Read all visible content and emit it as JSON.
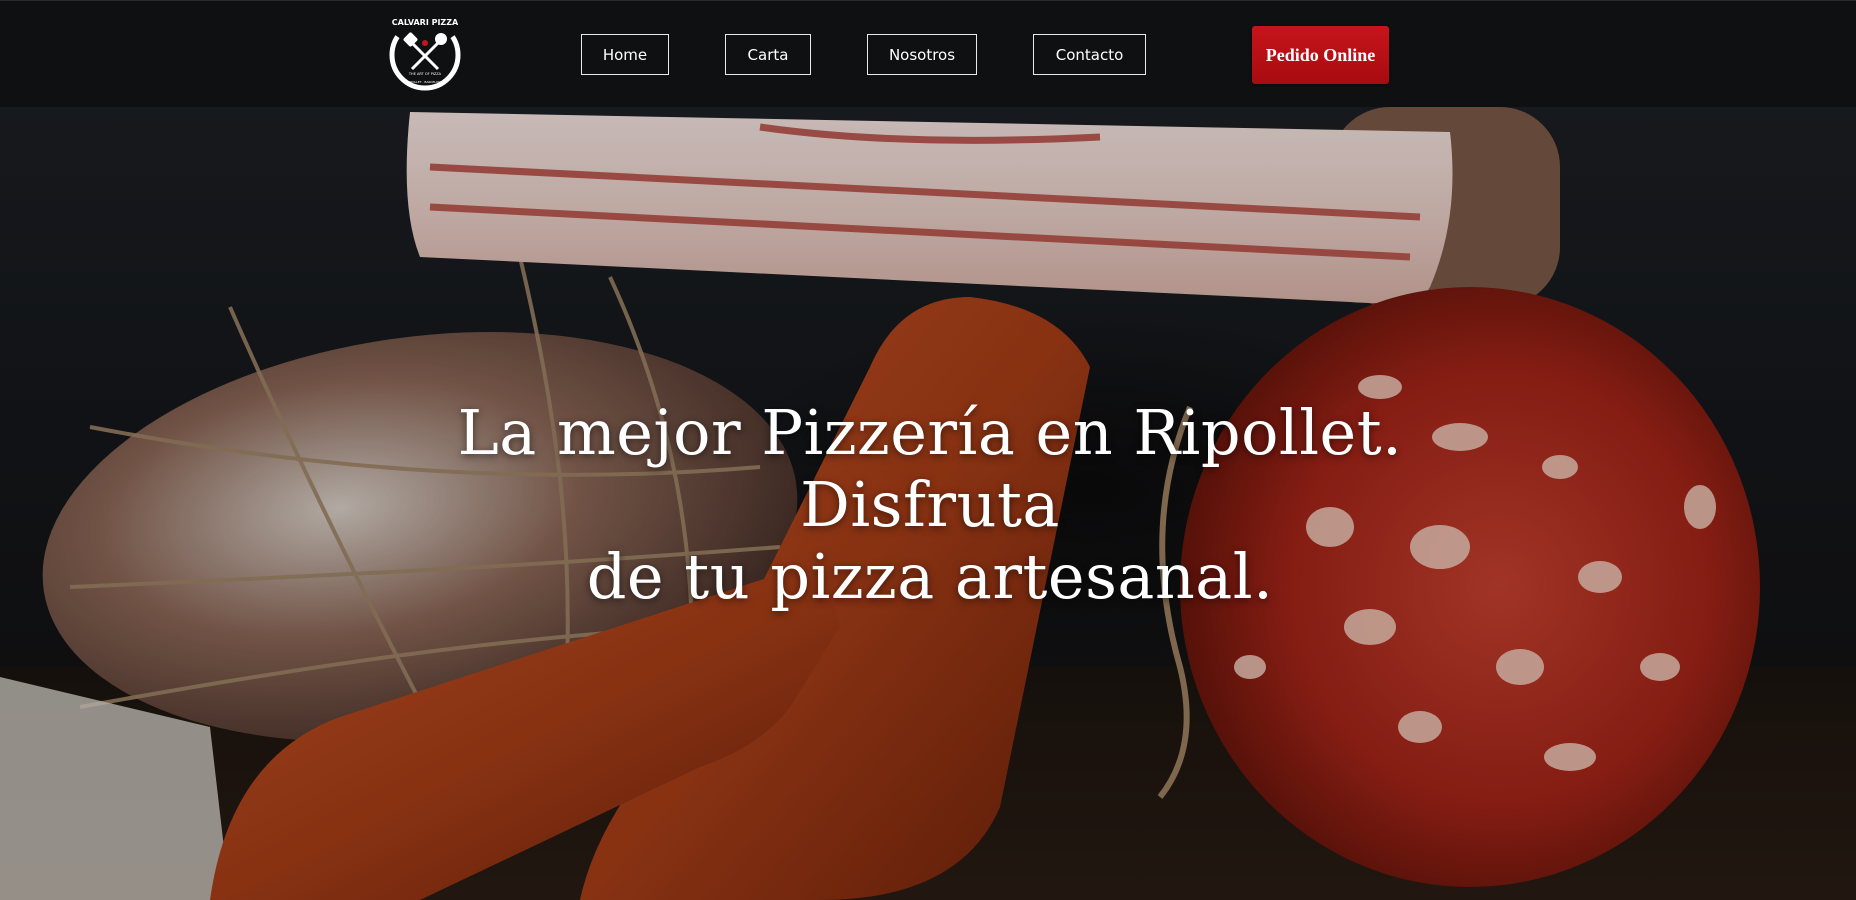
{
  "header": {
    "logo": {
      "text_top": "CALVARI PIZZA",
      "text_mid": "THE ART OF PIZZA",
      "text_bottom": "RIPOLLET · BARCELONA"
    },
    "nav": {
      "home": "Home",
      "carta": "Carta",
      "nosotros": "Nosotros",
      "contacto": "Contacto"
    },
    "order_button": "Pedido Online"
  },
  "hero": {
    "headline_line1": "La mejor Pizzería en Ripollet. Disfruta",
    "headline_line2": "de tu pizza artesanal."
  },
  "colors": {
    "header_bg": "#0f1012",
    "order_button_bg": "#c6151b",
    "nav_border": "#e9e9e9"
  }
}
